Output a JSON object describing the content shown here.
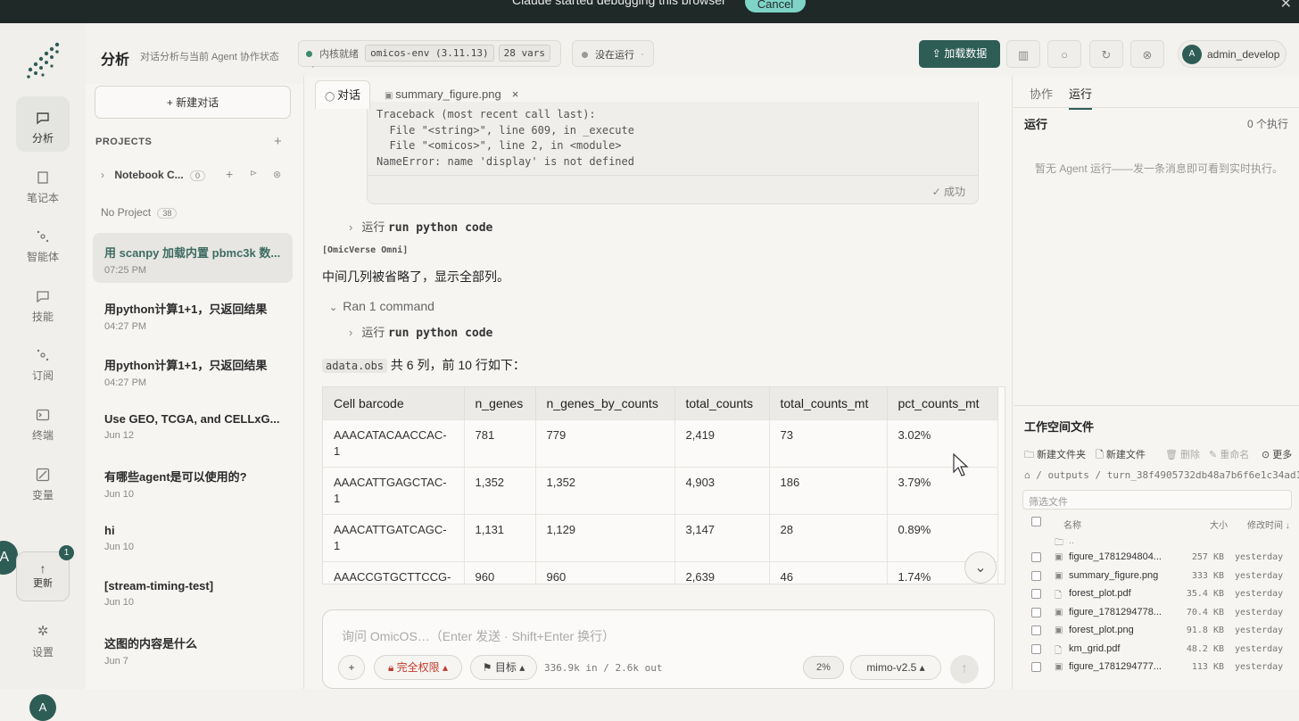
{
  "topbar": {
    "message": "Claude started debugging this browser",
    "cancel": "Cancel"
  },
  "rail": {
    "items": [
      {
        "label": "分析",
        "icon": "chat-icon"
      },
      {
        "label": "笔记本",
        "icon": "notebook-icon"
      },
      {
        "label": "智能体",
        "icon": "agent-icon"
      },
      {
        "label": "技能",
        "icon": "skill-icon"
      },
      {
        "label": "订阅",
        "icon": "subscription-icon"
      },
      {
        "label": "终端",
        "icon": "terminal-icon"
      },
      {
        "label": "变量",
        "icon": "variable-icon"
      }
    ],
    "update_label": "更新",
    "update_badge": "1",
    "settings_label": "设置",
    "avatar_partial": "A",
    "avatar_bottom": "A"
  },
  "header": {
    "title": "分析",
    "subtitle": "对话分析与当前 Agent 协作状态",
    "kernel_status": "内核就绪",
    "env": "omicos-env (3.11.13)",
    "vars": "28 vars",
    "run_status": "没在运行",
    "load_button": "加载数据",
    "user": "admin_develop",
    "user_initial": "A"
  },
  "sidebar": {
    "new_chat": "+ 新建对话",
    "projects_heading": "PROJECTS",
    "project": {
      "name": "Notebook C...",
      "count": "0"
    },
    "no_project": {
      "label": "No Project",
      "count": "38"
    },
    "conversations": [
      {
        "title": "用 scanpy 加载内置 pbmc3k 数...",
        "date": "07:25 PM"
      },
      {
        "title": "用python计算1+1，只返回结果",
        "date": "04:27 PM"
      },
      {
        "title": "用python计算1+1，只返回结果",
        "date": "04:27 PM"
      },
      {
        "title": "Use GEO, TCGA, and CELLxG...",
        "date": "Jun 12"
      },
      {
        "title": "有哪些agent是可以使用的?",
        "date": "Jun 10"
      },
      {
        "title": "hi",
        "date": "Jun 10"
      },
      {
        "title": "[stream-timing-test]",
        "date": "Jun 10"
      },
      {
        "title": "这图的内容是什么",
        "date": "Jun 7"
      }
    ]
  },
  "main": {
    "tabs": [
      {
        "label": "对话"
      },
      {
        "label": "summary_figure.png",
        "close": "×"
      }
    ],
    "traceback": "Traceback (most recent call last):\n  File \"<string>\", line 609, in _execute\n  File \"<omicos>\", line 2, in <module>\nNameError: name 'display' is not defined",
    "trace_status": "✓ 成功",
    "run_label": "运行",
    "run_code": "run python code",
    "author": "[OmicVerse Omni]",
    "reply": "中间几列被省略了，显示全部列。",
    "ran_command": "Ran 1 command",
    "obs_code": "adata.obs",
    "obs_text": " 共 6 列，前 10 行如下：",
    "table": {
      "headers": [
        "Cell barcode",
        "n_genes",
        "n_genes_by_counts",
        "total_counts",
        "total_counts_mt",
        "pct_counts_mt"
      ],
      "rows": [
        [
          "AAACATACAACCAC-1",
          "781",
          "779",
          "2,419",
          "73",
          "3.02%"
        ],
        [
          "AAACATTGAGCTAC-1",
          "1,352",
          "1,352",
          "4,903",
          "186",
          "3.79%"
        ],
        [
          "AAACATTGATCAGC-1",
          "1,131",
          "1,129",
          "3,147",
          "28",
          "0.89%"
        ],
        [
          "AAACCGTGCTTCCG-1",
          "960",
          "960",
          "2,639",
          "46",
          "1.74%"
        ]
      ]
    },
    "composer": {
      "placeholder": "询问 OmicOS…（Enter 发送 · Shift+Enter 换行）",
      "permission": "完全权限",
      "goal": "目标",
      "tokens": "336.9k in / 2.6k out",
      "context": "2%",
      "model": "mimo-v2.5"
    }
  },
  "right": {
    "tabs": [
      "协作",
      "运行"
    ],
    "run_heading": "运行",
    "run_count": "0 个执行",
    "run_empty": "暂无 Agent 运行——发一条消息即可看到实时执行。",
    "workspace": {
      "heading": "工作空间文件",
      "tools": [
        "新建文件夹",
        "新建文件",
        "删除",
        "重命名",
        "更多"
      ],
      "path": "/ outputs / turn_38f4905732db48a7b6f6e1c34ad1c5",
      "filter": "筛选文件",
      "columns": [
        "名称",
        "大小",
        "修改时间 ↓"
      ],
      "parent": "..",
      "files": [
        {
          "name": "figure_1781294804...",
          "size": "257 KB",
          "modified": "yesterday",
          "icon": "image-icon"
        },
        {
          "name": "summary_figure.png",
          "size": "333 KB",
          "modified": "yesterday",
          "icon": "image-icon"
        },
        {
          "name": "forest_plot.pdf",
          "size": "35.4 KB",
          "modified": "yesterday",
          "icon": "file-icon"
        },
        {
          "name": "figure_1781294778...",
          "size": "70.4 KB",
          "modified": "yesterday",
          "icon": "image-icon"
        },
        {
          "name": "forest_plot.png",
          "size": "91.8 KB",
          "modified": "yesterday",
          "icon": "image-icon"
        },
        {
          "name": "km_grid.pdf",
          "size": "48.2 KB",
          "modified": "yesterday",
          "icon": "file-icon"
        },
        {
          "name": "figure_1781294777...",
          "size": "113 KB",
          "modified": "yesterday",
          "icon": "image-icon"
        }
      ]
    }
  },
  "colors": {
    "accent": "#2e5d56",
    "danger": "#c0392b"
  }
}
